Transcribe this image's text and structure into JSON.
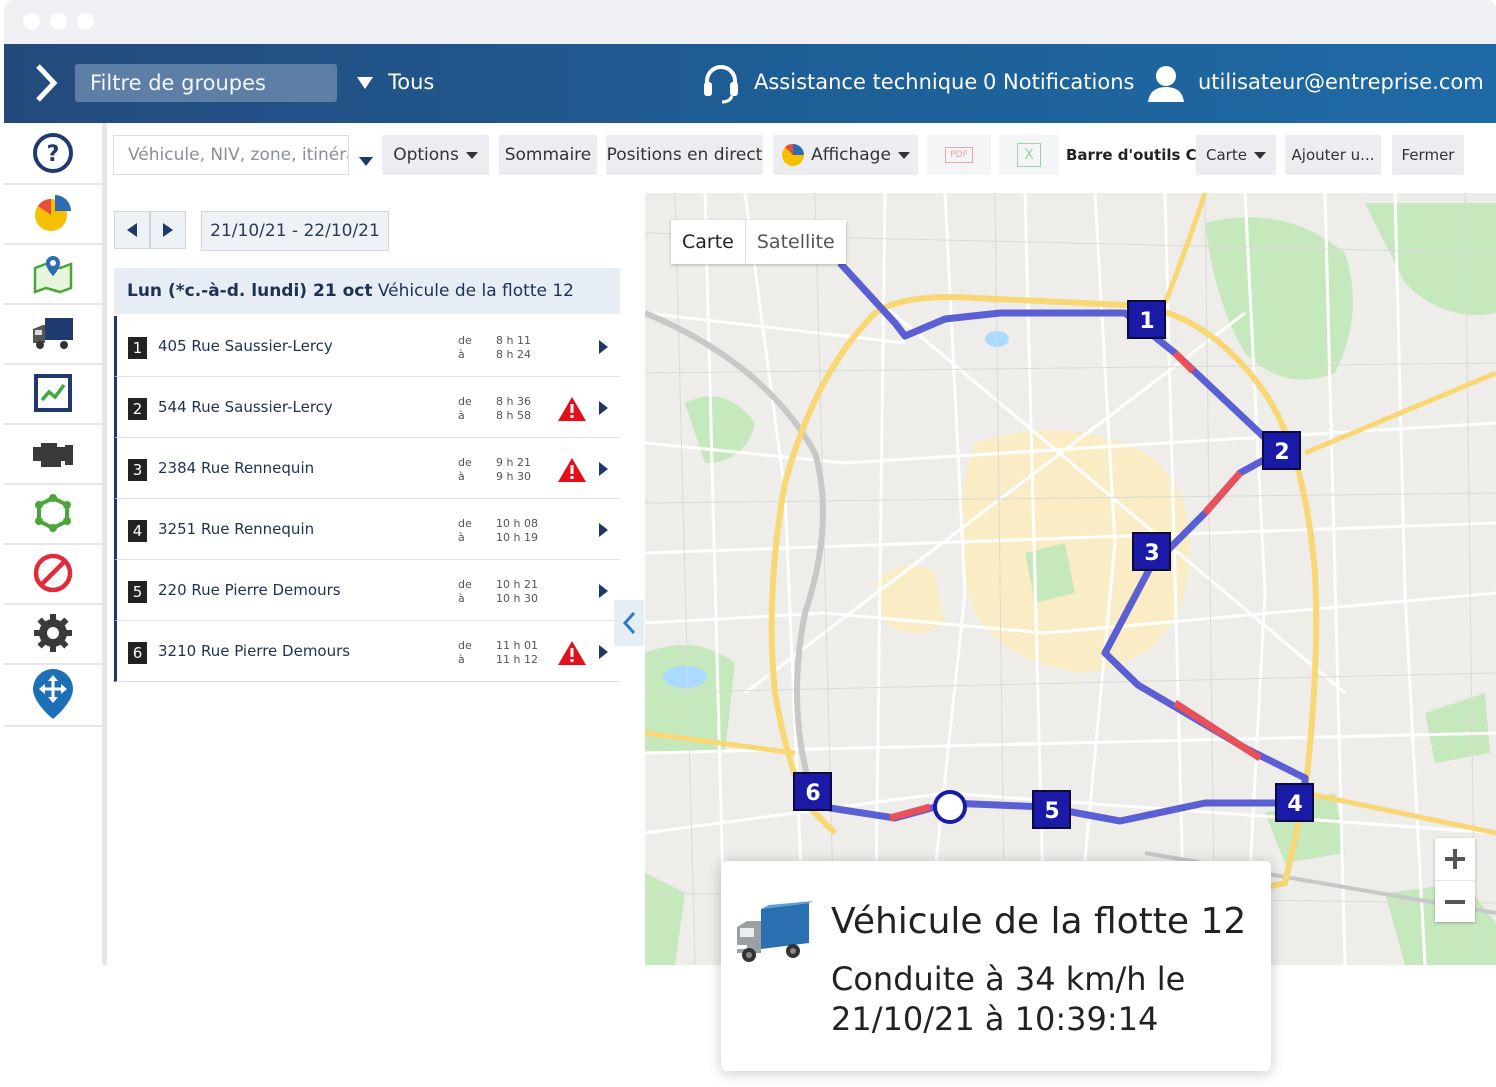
{
  "header": {
    "group_filter_placeholder": "Filtre de groupes",
    "group_value": "Tous",
    "support_label": "Assistance technique",
    "notifications_label": "0 Notifications",
    "user_email": "utilisateur@entreprise.com"
  },
  "sidebar": {
    "items": [
      {
        "icon": "help-icon"
      },
      {
        "icon": "pie-chart-icon"
      },
      {
        "icon": "map-pin-icon"
      },
      {
        "icon": "truck-icon"
      },
      {
        "icon": "trend-chart-icon"
      },
      {
        "icon": "engine-icon"
      },
      {
        "icon": "zone-icon"
      },
      {
        "icon": "prohibited-icon"
      },
      {
        "icon": "gear-icon"
      },
      {
        "icon": "navigation-pin-icon"
      }
    ]
  },
  "toolbar": {
    "search_placeholder": "Véhicule, NIV, zone, itinéra...",
    "options_label": "Options",
    "summary_label": "Sommaire",
    "live_positions_label": "Positions en direct",
    "display_label": "Affichage",
    "pdf_label": "PDF",
    "excel_label": "X",
    "toolbar_title": "Barre d'outils C...",
    "map_select": "Carte",
    "add_label": "Ajouter u...",
    "close_label": "Fermer"
  },
  "trip": {
    "date_range": "21/10/21 - 22/10/21",
    "day_bold": "Lun (*c.-à-d. lundi) 21 oct",
    "vehicle": "Véhicule de la flotte 12",
    "from_label": "de",
    "to_label": "à",
    "stops": [
      {
        "num": "1",
        "address": "405 Rue Saussier-Lercy",
        "from": "8 h 11",
        "to": "8 h 24",
        "warning": false
      },
      {
        "num": "2",
        "address": "544 Rue Saussier-Lercy",
        "from": "8 h 36",
        "to": "8 h 58",
        "warning": true
      },
      {
        "num": "3",
        "address": "2384 Rue Rennequin",
        "from": "9 h 21",
        "to": "9 h 30",
        "warning": true
      },
      {
        "num": "4",
        "address": "3251 Rue Rennequin",
        "from": "10 h 08",
        "to": "10 h 19",
        "warning": false
      },
      {
        "num": "5",
        "address": "220 Rue Pierre Demours",
        "from": "10 h 21",
        "to": "10 h 30",
        "warning": false
      },
      {
        "num": "6",
        "address": "3210 Rue Pierre Demours",
        "from": "11 h 01",
        "to": "11 h 12",
        "warning": true
      }
    ]
  },
  "map": {
    "mode_map": "Carte",
    "mode_satellite": "Satellite",
    "route_color": "#5b5fd4",
    "speeding_color": "#e8505b",
    "marker_color": "#1a1aa6",
    "markers": [
      "1",
      "2",
      "3",
      "4",
      "5",
      "6"
    ]
  },
  "popup": {
    "vehicle": "Véhicule de la flotte 12",
    "status": "Conduite à 34 km/h le 21/10/21 à 10:39:14"
  }
}
